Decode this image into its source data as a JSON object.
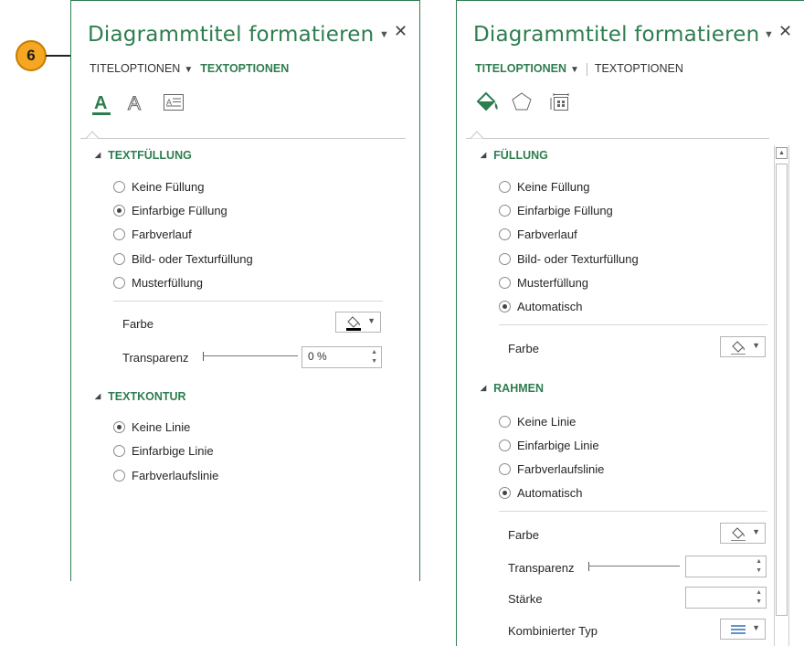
{
  "callout": {
    "number": "6"
  },
  "left_pane": {
    "title": "Diagrammtitel formatieren",
    "tabs": {
      "title_options": "TITELOPTIONEN",
      "text_options": "TEXTOPTIONEN",
      "active": "text_options"
    },
    "icons": [
      "text-fill-outline-icon",
      "text-effects-icon",
      "textbox-icon"
    ],
    "sections": {
      "text_fill": {
        "header": "TEXTFÜLLUNG",
        "options": [
          {
            "label": "Keine Füllung",
            "checked": false
          },
          {
            "label": "Einfarbige Füllung",
            "checked": true
          },
          {
            "label": "Farbverlauf",
            "checked": false
          },
          {
            "label": "Bild- oder Texturfüllung",
            "checked": false
          },
          {
            "label": "Musterfüllung",
            "checked": false
          }
        ],
        "color_label": "Farbe",
        "transparency_label": "Transparenz",
        "transparency_value": "0 %"
      },
      "text_outline": {
        "header": "TEXTKONTUR",
        "options": [
          {
            "label": "Keine Linie",
            "checked": true
          },
          {
            "label": "Einfarbige Linie",
            "checked": false
          },
          {
            "label": "Farbverlaufslinie",
            "checked": false
          }
        ]
      }
    }
  },
  "right_pane": {
    "title": "Diagrammtitel formatieren",
    "tabs": {
      "title_options": "TITELOPTIONEN",
      "text_options": "TEXTOPTIONEN",
      "active": "title_options"
    },
    "icons": [
      "fill-line-icon",
      "effects-icon",
      "size-properties-icon"
    ],
    "sections": {
      "fill": {
        "header": "FÜLLUNG",
        "options": [
          {
            "label": "Keine Füllung",
            "checked": false
          },
          {
            "label": "Einfarbige Füllung",
            "checked": false
          },
          {
            "label": "Farbverlauf",
            "checked": false
          },
          {
            "label": "Bild- oder Texturfüllung",
            "checked": false
          },
          {
            "label": "Musterfüllung",
            "checked": false
          },
          {
            "label": "Automatisch",
            "checked": true
          }
        ],
        "color_label": "Farbe"
      },
      "border": {
        "header": "RAHMEN",
        "options": [
          {
            "label": "Keine Linie",
            "checked": false
          },
          {
            "label": "Einfarbige Linie",
            "checked": false
          },
          {
            "label": "Farbverlaufslinie",
            "checked": false
          },
          {
            "label": "Automatisch",
            "checked": true
          }
        ],
        "color_label": "Farbe",
        "transparency_label": "Transparenz",
        "transparency_value": "",
        "width_label": "Stärke",
        "width_value": "",
        "compound_label": "Kombinierter Typ"
      }
    }
  },
  "colors": {
    "accent": "#2e7d4f",
    "callout": "#f5a623"
  }
}
